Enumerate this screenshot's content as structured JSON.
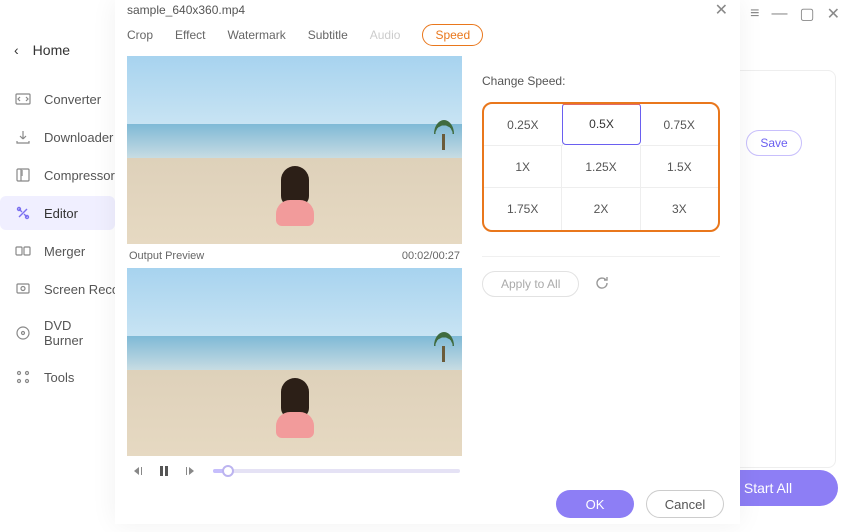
{
  "window": {
    "hamburger": "≡",
    "minimize": "—",
    "maximize": "▢",
    "close": "✕"
  },
  "sidebar": {
    "back_icon": "‹",
    "home": "Home",
    "items": [
      {
        "label": "Converter"
      },
      {
        "label": "Downloader"
      },
      {
        "label": "Compressor"
      },
      {
        "label": "Editor"
      },
      {
        "label": "Merger"
      },
      {
        "label": "Screen Recorder"
      },
      {
        "label": "DVD Burner"
      },
      {
        "label": "Tools"
      }
    ],
    "active_index": 3
  },
  "background": {
    "save": "Save",
    "start_all": "Start All"
  },
  "editor": {
    "filename": "sample_640x360.mp4",
    "close": "✕",
    "tabs": [
      {
        "label": "Crop"
      },
      {
        "label": "Effect"
      },
      {
        "label": "Watermark"
      },
      {
        "label": "Subtitle"
      },
      {
        "label": "Audio",
        "disabled": true
      },
      {
        "label": "Speed",
        "active": true
      }
    ],
    "preview_label": "Output Preview",
    "timecode": "00:02/00:27",
    "speed": {
      "title": "Change Speed:",
      "options": [
        [
          "0.25X",
          "0.5X",
          "0.75X"
        ],
        [
          "1X",
          "1.25X",
          "1.5X"
        ],
        [
          "1.75X",
          "2X",
          "3X"
        ]
      ],
      "selected": "0.5X"
    },
    "apply_all": "Apply to All",
    "ok": "OK",
    "cancel": "Cancel"
  }
}
